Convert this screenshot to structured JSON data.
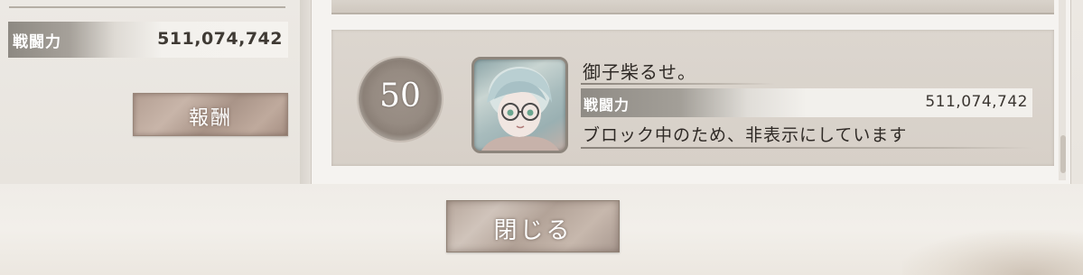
{
  "left_panel": {
    "power_label": "戦闘力",
    "power_value": "511,074,742",
    "reward_button_label": "報酬"
  },
  "ranking_entry": {
    "rank": "50",
    "player_name": "御子柴るせ。",
    "power_label": "戦闘力",
    "power_value": "511,074,742",
    "status_message": "ブロック中のため、非表示にしています",
    "avatar_icon": "character-portrait-icon"
  },
  "footer": {
    "close_button_label": "閉じる"
  },
  "colors": {
    "accent_bar_dark": "#8d8982",
    "button_tone": "#b49f93",
    "card_background": "#dcd6cf",
    "text_dark": "#2f2a26"
  }
}
